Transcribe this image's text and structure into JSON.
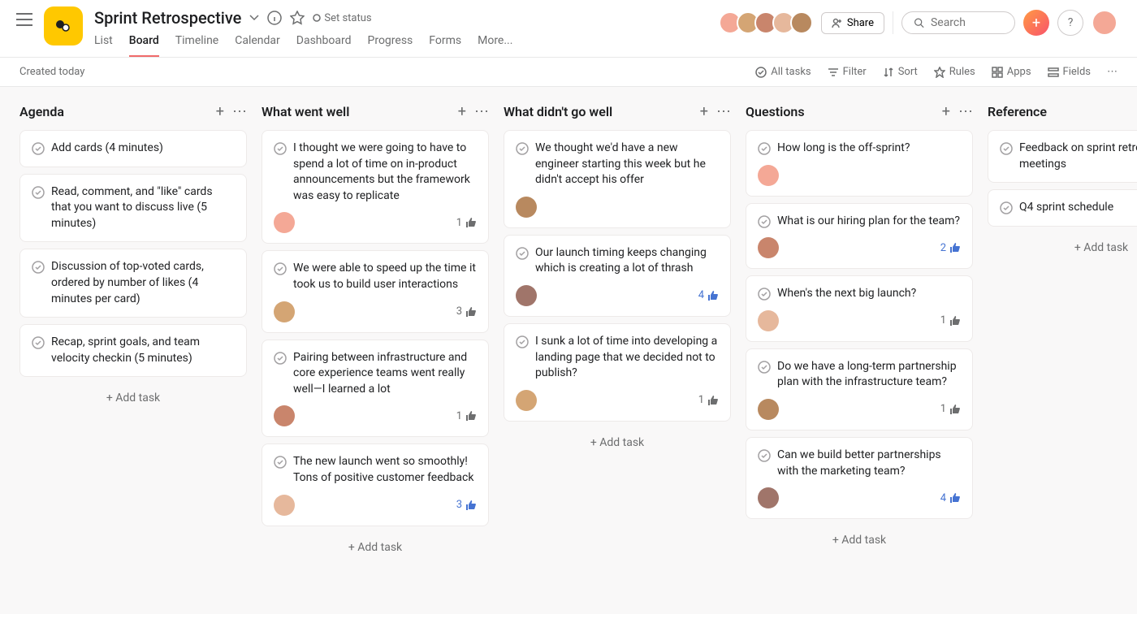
{
  "header": {
    "title": "Sprint Retrospective",
    "set_status": "Set status",
    "tabs": [
      "List",
      "Board",
      "Timeline",
      "Calendar",
      "Dashboard",
      "Progress",
      "Forms",
      "More..."
    ],
    "active_tab": 1,
    "share": "Share",
    "search_placeholder": "Search",
    "help": "?",
    "member_colors": [
      "#f4a896",
      "#d4a574",
      "#c9856c",
      "#e6b89c",
      "#b8895f"
    ]
  },
  "toolbar": {
    "created": "Created today",
    "items": [
      "All tasks",
      "Filter",
      "Sort",
      "Rules",
      "Apps",
      "Fields"
    ]
  },
  "add_task": "Add task",
  "columns": [
    {
      "name": "Agenda",
      "cards": [
        {
          "text": "Add cards (4 minutes)"
        },
        {
          "text": "Read, comment, and \"like\" cards that you want to discuss live (5 minutes)"
        },
        {
          "text": "Discussion of top-voted cards, ordered by number of likes (4 minutes per card)"
        },
        {
          "text": "Recap, sprint goals, and team velocity checkin (5 minutes)"
        }
      ]
    },
    {
      "name": "What went well",
      "cards": [
        {
          "text": "I thought we were going to have to spend a lot of time on in-product announcements but the framework was easy to replicate",
          "avatar": "c1",
          "likes": 1,
          "like_blue": false
        },
        {
          "text": "We were able to speed up the time it took us to build user interactions",
          "avatar": "c2",
          "likes": 3,
          "like_blue": false
        },
        {
          "text": "Pairing between infrastructure and core experience teams went really well—I learned a lot",
          "avatar": "c3",
          "likes": 1,
          "like_blue": false
        },
        {
          "text": "The new launch went so smoothly! Tons of positive customer feedback",
          "avatar": "c4",
          "likes": 3,
          "like_blue": true
        }
      ]
    },
    {
      "name": "What didn't go well",
      "cards": [
        {
          "text": "We thought we'd have a new engineer starting this week but he didn't accept his offer",
          "avatar": "c5"
        },
        {
          "text": "Our launch timing keeps changing which is creating a lot of thrash",
          "avatar": "c6",
          "likes": 4,
          "like_blue": true
        },
        {
          "text": "I sunk a lot of time into developing a landing page that we decided not to publish?",
          "avatar": "c2",
          "likes": 1,
          "like_blue": false
        }
      ]
    },
    {
      "name": "Questions",
      "cards": [
        {
          "text": "How long is the off-sprint?",
          "avatar": "c1"
        },
        {
          "text": "What is our hiring plan for the team?",
          "avatar": "c3",
          "likes": 2,
          "like_blue": true
        },
        {
          "text": "When's the next big launch?",
          "avatar": "c4",
          "likes": 1,
          "like_blue": false
        },
        {
          "text": "Do we have a long-term partnership plan with the infrastructure team?",
          "avatar": "c5",
          "likes": 1,
          "like_blue": false
        },
        {
          "text": "Can we build better partnerships with the marketing team?",
          "avatar": "c6",
          "likes": 4,
          "like_blue": true
        }
      ]
    },
    {
      "name": "Reference",
      "cards": [
        {
          "text": "Feedback on sprint retrosp meetings"
        },
        {
          "text": "Q4 sprint schedule"
        }
      ]
    }
  ]
}
